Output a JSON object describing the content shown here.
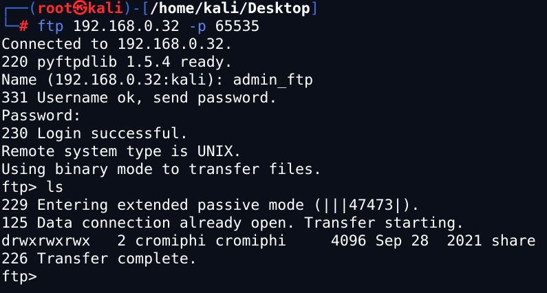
{
  "prompt": {
    "corner_top": "┌──",
    "paren_open": "(",
    "user": "root",
    "skull": "㉿",
    "host": "kali",
    "paren_close": ")",
    "dash": "-",
    "bracket_open": "[",
    "path": "/home/kali/Desktop",
    "bracket_close": "]",
    "corner_bottom": "└─",
    "hash": "#",
    "command": "ftp",
    "arg_ip": "192.168.0.32",
    "arg_flag": "-p",
    "arg_port": "65535"
  },
  "output": [
    "Connected to 192.168.0.32.",
    "220 pyftpdlib 1.5.4 ready.",
    "Name (192.168.0.32:kali): admin_ftp",
    "331 Username ok, send password.",
    "Password:",
    "230 Login successful.",
    "Remote system type is UNIX.",
    "Using binary mode to transfer files.",
    "ftp> ls",
    "229 Entering extended passive mode (|||47473|).",
    "125 Data connection already open. Transfer starting.",
    "drwxrwxrwx   2 cromiphi cromiphi     4096 Sep 28  2021 share",
    "226 Transfer complete.",
    "ftp>"
  ],
  "colors": {
    "background": "#0b0f1a",
    "prompt_blue": "#3f6fe0",
    "prompt_red": "#ff2a2a",
    "command_blue": "#5a86f2",
    "text": "#ffffff"
  }
}
